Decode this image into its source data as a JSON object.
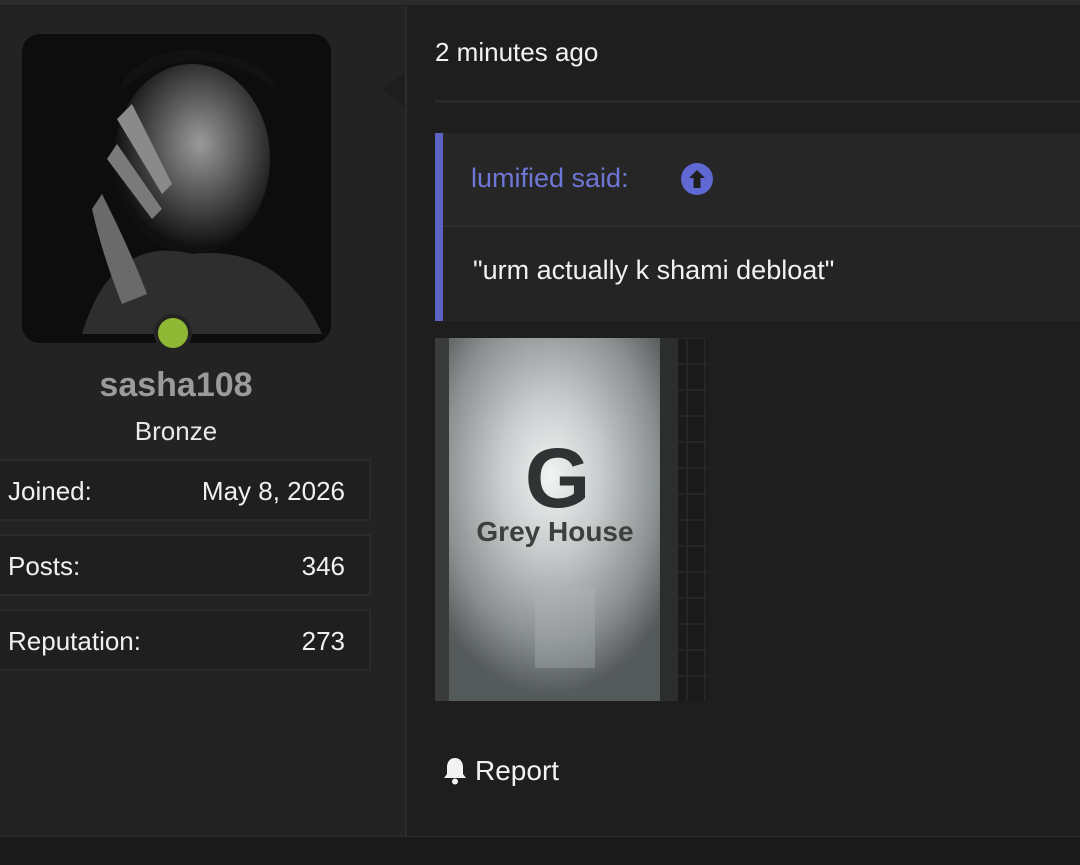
{
  "user": {
    "username": "sasha108",
    "title": "Bronze",
    "online_color": "#8fb935",
    "stats": [
      {
        "label": "Joined:",
        "value": "May 8, 2026"
      },
      {
        "label": "Posts:",
        "value": "346"
      },
      {
        "label": "Reputation:",
        "value": "273"
      }
    ]
  },
  "post": {
    "time": "2 minutes ago",
    "quote": {
      "author_label": "lumified said:",
      "icon": "arrow-up-circle-icon",
      "text": "\"urm actually k shami debloat\""
    },
    "attachment": {
      "sign_letter": "G",
      "sign_text": "Grey House"
    },
    "report_label": "Report",
    "report_icon": "bell-icon"
  },
  "colors": {
    "accent": "#5b63c3",
    "quote_author": "#6f77d6",
    "background": "#1e1e1e"
  }
}
